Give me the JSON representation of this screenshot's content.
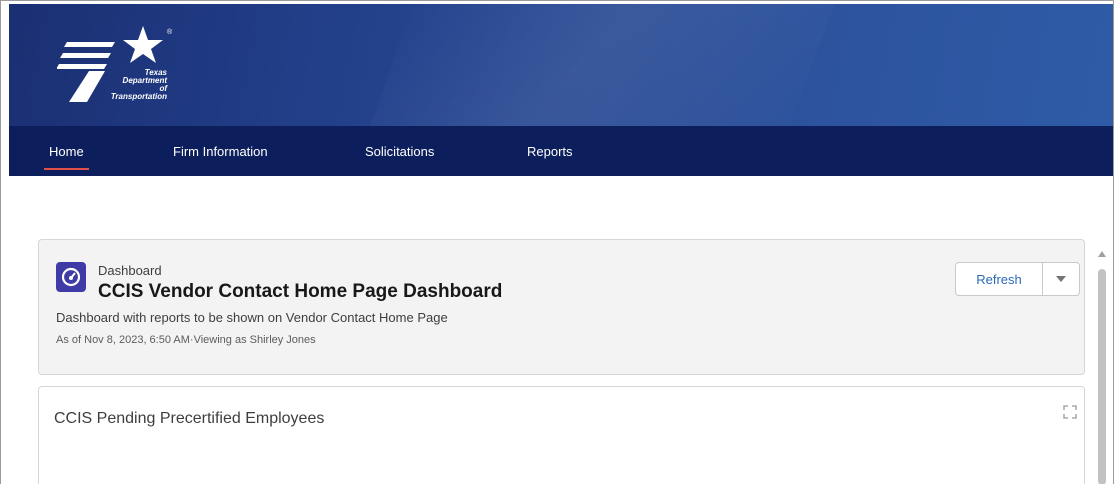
{
  "brand": {
    "logo_lines": [
      "Texas",
      "Department",
      "of Transportation"
    ],
    "registered_mark": "®"
  },
  "nav": {
    "items": [
      {
        "label": "Home",
        "active": true
      },
      {
        "label": "Firm Information",
        "active": false
      },
      {
        "label": "Solicitations",
        "active": false
      },
      {
        "label": "Reports",
        "active": false
      }
    ]
  },
  "dashboard": {
    "label": "Dashboard",
    "title": "CCIS Vendor Contact Home Page Dashboard",
    "description": "Dashboard with reports to be shown on Vendor Contact Home Page",
    "meta": "As of Nov 8, 2023, 6:50 AM·Viewing as Shirley Jones",
    "refresh_label": "Refresh",
    "icon": "gauge-icon"
  },
  "report": {
    "title": "CCIS Pending Precertified Employees",
    "icon": "expand-icon"
  },
  "colors": {
    "nav_bg": "#0c1f5c",
    "banner_bg": "#22408a",
    "active_underline": "#e0504a",
    "dashboard_icon_bg": "#3e3aa6",
    "link_blue": "#2a6bb8"
  }
}
